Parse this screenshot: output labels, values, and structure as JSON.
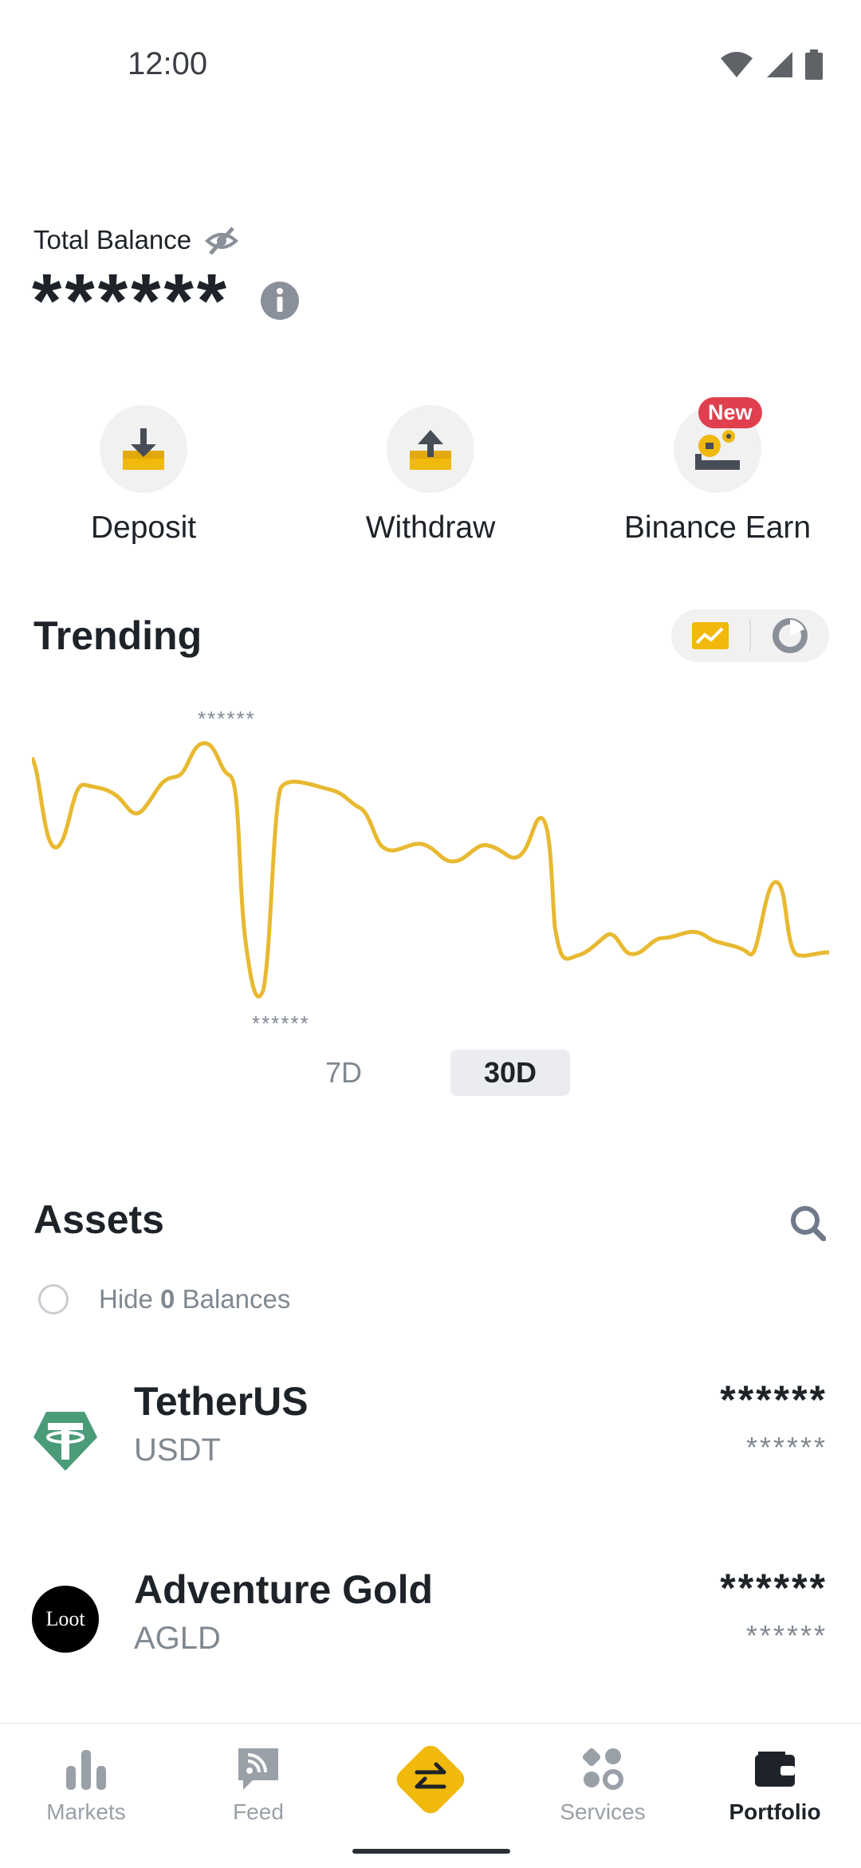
{
  "status_bar": {
    "time": "12:00"
  },
  "balance": {
    "label": "Total Balance",
    "value": "******"
  },
  "actions": [
    {
      "label": "Deposit",
      "icon": "deposit-icon"
    },
    {
      "label": "Withdraw",
      "icon": "withdraw-icon"
    },
    {
      "label": "Binance Earn",
      "icon": "earn-icon",
      "badge": "New"
    }
  ],
  "trending": {
    "title": "Trending",
    "high_marker": "******",
    "low_marker": "******",
    "ranges": [
      "7D",
      "30D"
    ],
    "selected_range": "30D"
  },
  "assets": {
    "title": "Assets",
    "hide_label_prefix": "Hide",
    "hide_label_count": "0",
    "hide_label_suffix": "Balances",
    "items": [
      {
        "name": "TetherUS",
        "symbol": "USDT",
        "amount": "******",
        "value": "******",
        "logo_text": ""
      },
      {
        "name": "Adventure Gold",
        "symbol": "AGLD",
        "amount": "******",
        "value": "******",
        "logo_text": "Loot"
      }
    ]
  },
  "bottom_nav": [
    {
      "label": "Markets",
      "icon": "markets-icon"
    },
    {
      "label": "Feed",
      "icon": "feed-icon"
    },
    {
      "label": "",
      "icon": "trade-icon"
    },
    {
      "label": "Services",
      "icon": "services-icon"
    },
    {
      "label": "Portfolio",
      "icon": "wallet-icon"
    }
  ],
  "colors": {
    "accent": "#f0b90b",
    "chart_line": "#e8b931",
    "badge": "#e0404d",
    "tether": "#4a9c78"
  }
}
